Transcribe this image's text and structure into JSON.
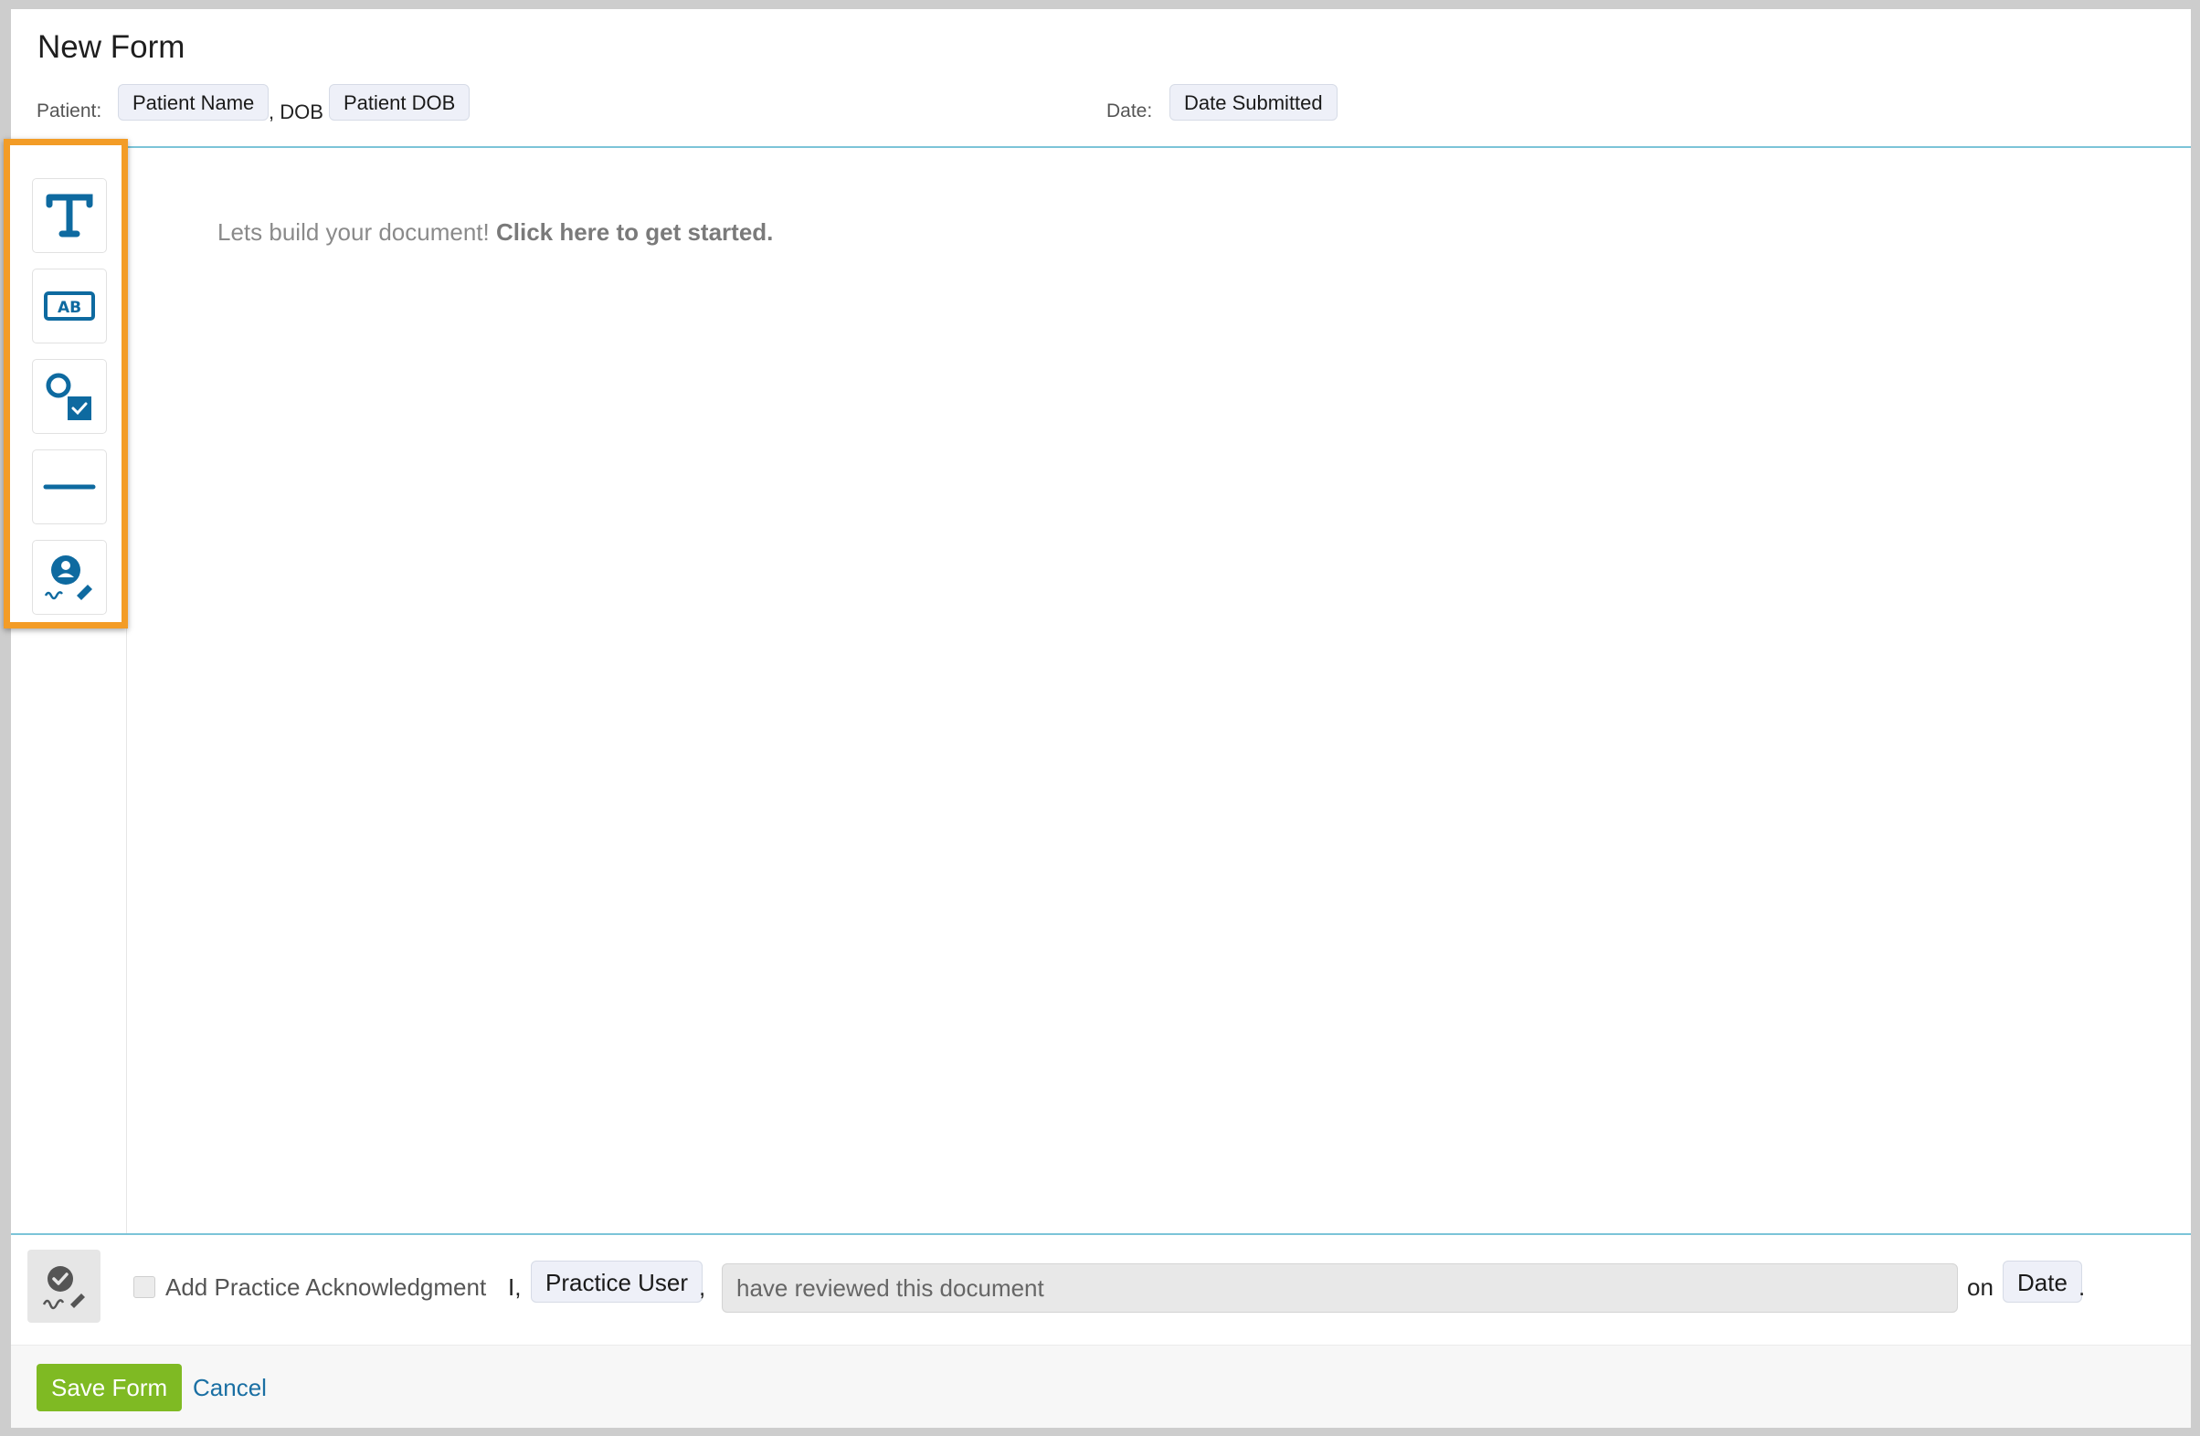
{
  "header": {
    "title": "New Form",
    "patient_label": "Patient:",
    "patient_name": "Patient Name",
    "dob_sep": ", DOB",
    "patient_dob": "Patient DOB",
    "date_label": "Date:",
    "date_submitted": "Date Submitted"
  },
  "canvas": {
    "prompt_text": "Lets build your document! ",
    "prompt_link": "Click here to get started."
  },
  "toolbar": {
    "items": [
      {
        "icon": "text-icon"
      },
      {
        "icon": "text-field-icon"
      },
      {
        "icon": "choice-icon"
      },
      {
        "icon": "divider-icon"
      },
      {
        "icon": "signature-icon"
      }
    ]
  },
  "acknowledgment": {
    "checkbox_label": "Add Practice Acknowledgment",
    "i_text": "I,",
    "user_chip": "Practice User",
    "comma": ",",
    "statement_value": "have reviewed this document",
    "on_text": "on",
    "date_chip": "Date",
    "period": "."
  },
  "footer": {
    "save_label": "Save Form",
    "cancel_label": "Cancel"
  },
  "colors": {
    "accent_blue": "#0e6aa0",
    "highlight_orange": "#f39c26",
    "save_green": "#7fba23"
  }
}
